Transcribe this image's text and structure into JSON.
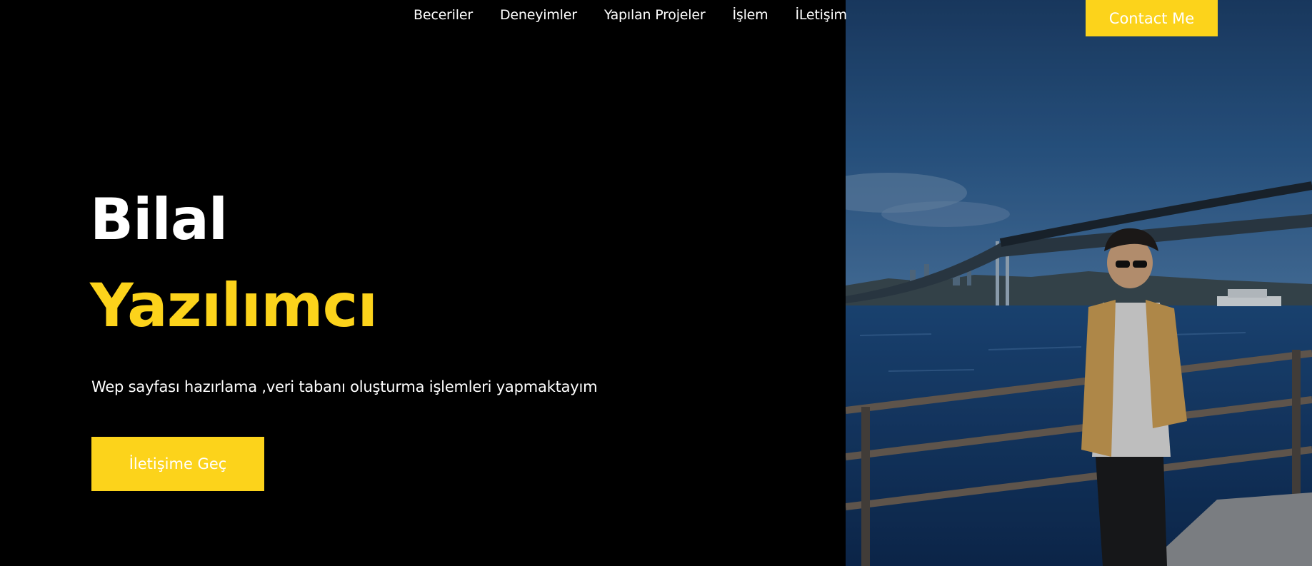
{
  "nav": {
    "items": [
      {
        "label": "Beceriler"
      },
      {
        "label": "Deneyimler"
      },
      {
        "label": "Yapılan Projeler"
      },
      {
        "label": "İşlem"
      },
      {
        "label": "İLetişim"
      }
    ],
    "contact_label": "Contact Me"
  },
  "hero": {
    "name": "Bilal",
    "role": "Yazılımcı",
    "description": "Wep sayfası hazırlama ,veri tabanı oluşturma işlemleri yapmaktayım",
    "cta_label": "İletişime Geç"
  },
  "colors": {
    "accent": "#fcd31b",
    "background": "#000000",
    "text": "#ffffff"
  }
}
